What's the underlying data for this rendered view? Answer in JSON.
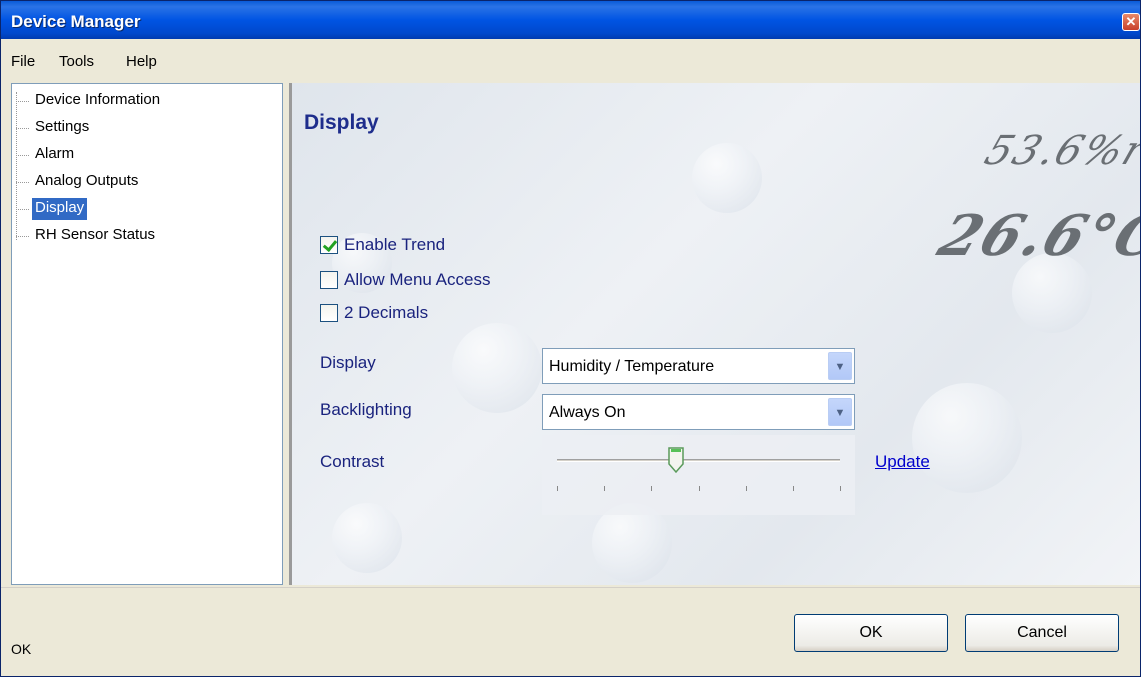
{
  "window": {
    "title": "Device Manager",
    "close_glyph": "✕"
  },
  "menu": {
    "items": [
      "File",
      "Tools",
      "Help"
    ]
  },
  "tree": {
    "items": [
      {
        "label": "Device Information",
        "selected": false
      },
      {
        "label": "Settings",
        "selected": false
      },
      {
        "label": "Alarm",
        "selected": false
      },
      {
        "label": "Analog Outputs",
        "selected": false
      },
      {
        "label": "Display",
        "selected": true
      },
      {
        "label": "RH Sensor Status",
        "selected": false
      }
    ]
  },
  "panel": {
    "title": "Display",
    "checkboxes": [
      {
        "label": "Enable Trend",
        "checked": true
      },
      {
        "label": "Allow Menu Access",
        "checked": false
      },
      {
        "label": "2 Decimals",
        "checked": false
      }
    ],
    "display": {
      "label": "Display",
      "value": "Humidity / Temperature"
    },
    "backlighting": {
      "label": "Backlighting",
      "value": "Always On"
    },
    "contrast": {
      "label": "Contrast",
      "position_fraction": 0.42,
      "tick_count": 7
    },
    "update_link": "Update"
  },
  "buttons": {
    "ok": "OK",
    "cancel": "Cancel"
  },
  "status": {
    "text": "OK"
  },
  "colors": {
    "title_bar": "#0054e3",
    "selection": "#316ac5",
    "panel_title": "#1e2d8c",
    "link": "#0000cc"
  },
  "icons": {
    "close": "close-icon",
    "combo_arrow": "chevron-down-icon",
    "check": "checkmark-icon",
    "slider_thumb": "slider-thumb-icon"
  }
}
